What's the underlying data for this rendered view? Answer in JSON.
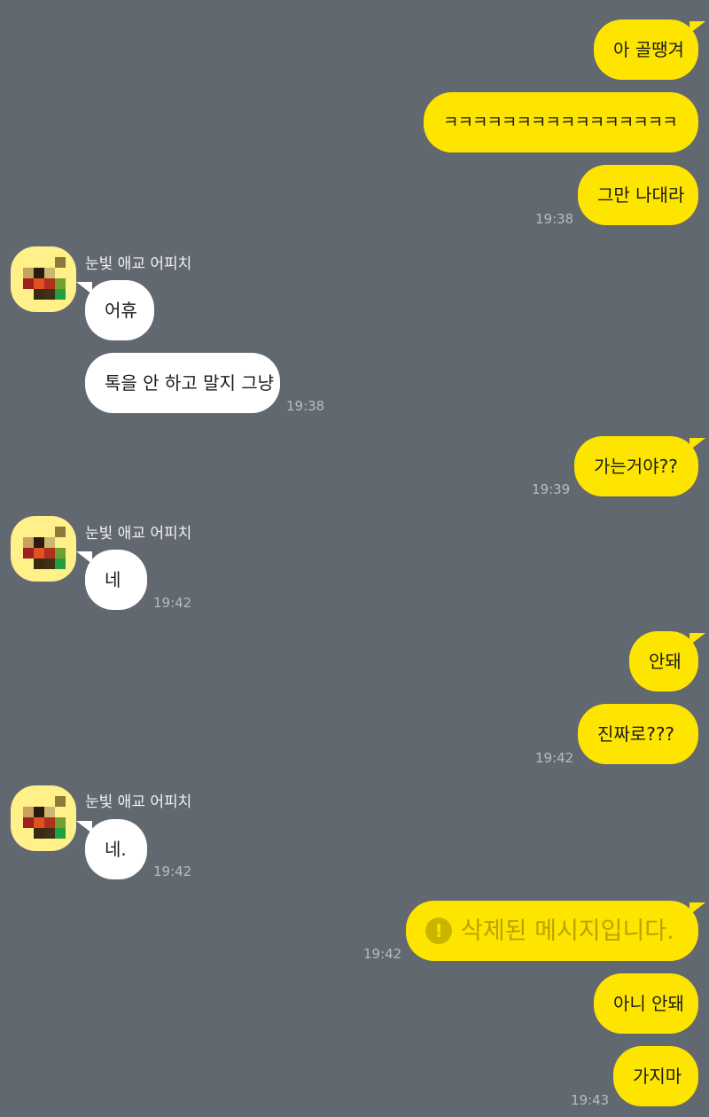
{
  "chat": {
    "sender_name": "눈빛 애교 어피치",
    "messages": {
      "m1": "아 골땡겨",
      "m2": "ㅋㅋㅋㅋㅋㅋㅋㅋㅋㅋㅋㅋㅋㅋㅋㅋ",
      "m3": "그만 나대라",
      "m4": "어휴",
      "m5": "톡을 안 하고 말지 그냥",
      "m6": "가는거야??",
      "m7": "네",
      "m8": "안돼",
      "m9": "진짜로???",
      "m10": "네.",
      "m11": "삭제된 메시지입니다.",
      "m12": "아니 안돼",
      "m13": "가지마"
    },
    "times": {
      "t1": "19:38",
      "t2": "19:38",
      "t3": "19:39",
      "t4": "19:42",
      "t5": "19:42",
      "t6": "19:42",
      "t7": "19:42",
      "t8": "19:43"
    },
    "deleted_icon": "exclamation-icon"
  },
  "colors": {
    "background": "#626870",
    "my_bubble": "#fee500",
    "their_bubble": "#ffffff",
    "time_text": "#b7bcc2"
  }
}
